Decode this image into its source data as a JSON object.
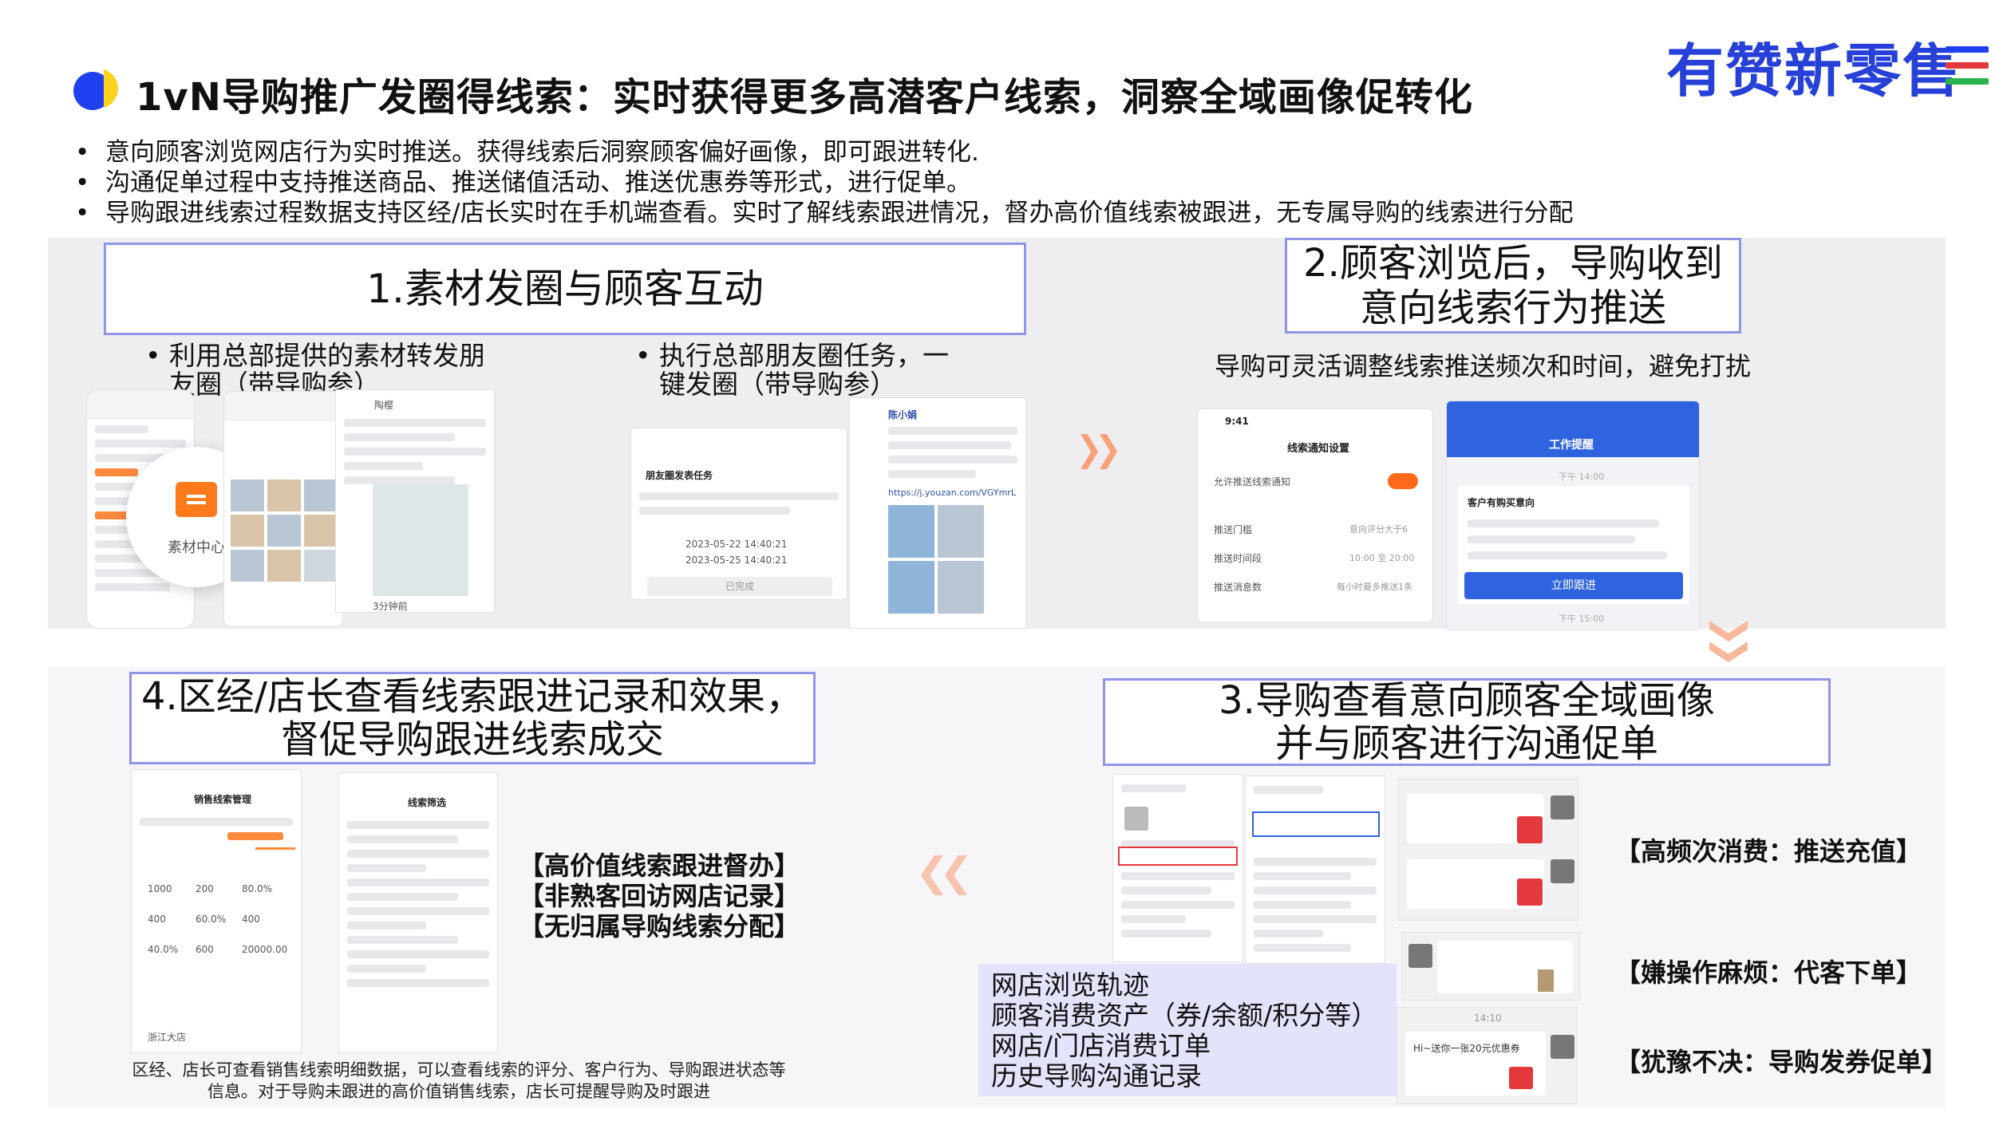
{
  "header": {
    "title": "1vN导购推广发圈得线索：实时获得更多高潜客户线索，洞察全域画像促转化",
    "brand": "有赞新零售",
    "brand_bar_colors": [
      "#1f3ff0",
      "#e4393c",
      "#2bb24c"
    ]
  },
  "bullets": [
    "意向顾客浏览网店行为实时推送。获得线索后洞察顾客偏好画像，即可跟进转化.",
    "沟通促单过程中支持推送商品、推送储值活动、推送优惠券等形式，进行促单。",
    "导购跟进线索过程数据支持区经/店长实时在手机端查看。实时了解线索跟进情况，督办高价值线索被跟进，无专属导购的线索进行分配"
  ],
  "step1": {
    "title": "1.素材发圈与顾客互动",
    "bullet_a": "利用总部提供的素材转发朋友圈（带导购参）",
    "bullet_b": "执行总部朋友圈任务，一键发圈（带导购参）",
    "circle_label": "素材中心",
    "task_title": "朋友圈发表任务",
    "task_done": "已完成",
    "task_start": "2023-05-22 14:40:21",
    "task_end": "2023-05-25 14:40:21",
    "moment_user": "陈小娟",
    "moment_link": "https://j.youzan.com/VGYmrL",
    "moment_user2": "陶樱",
    "moment_time": "3分钟前"
  },
  "step2": {
    "title_line1": "2.顾客浏览后，导购收到",
    "title_line2": "意向线索行为推送",
    "note": "导购可灵活调整线索推送频次和时间，避免打扰",
    "screen1_title": "线索通知设置",
    "screen1_rows": [
      "允许推送线索通知",
      "推送门槛",
      "推送时间段",
      "推送消息数"
    ],
    "screen1_values": [
      "",
      "意向评分大于6",
      "10:00 至 20:00",
      "每小时最多推送1条"
    ],
    "screen2_title": "工作提醒",
    "screen2_card_title": "客户有购买意向",
    "screen2_button": "立即跟进",
    "time_a": "下午 14:00",
    "time_b": "下午 15:00",
    "clock": "9:41"
  },
  "step3": {
    "title_line1": "3.导购查看意向顾客全域画像",
    "title_line2": "并与顾客进行沟通促单",
    "profile_items": [
      "网店浏览轨迹",
      "顾客消费资产（券/余额/积分等）",
      "网店/门店消费订单",
      "历史导购沟通记录"
    ],
    "tags": [
      "【高频次消费：推送充值】",
      "【嫌操作麻烦：代客下单】",
      "【犹豫不决：导购发券促单】"
    ],
    "chat_time": "14:10",
    "chat_coupon": "Hi~送你一张20元优惠券"
  },
  "step4": {
    "title_line1": "4.区经/店长查看线索跟进记录和效果，",
    "title_line2": "督促导购跟进线索成交",
    "tags": [
      "【高价值线索跟进督办】",
      "【非熟客回访网店记录】",
      "【无归属导购线索分配】"
    ],
    "caption": "区经、店长可查看销售线索明细数据，可以查看线索的评分、客户行为、导购跟进状态等信息。对于导购未跟进的高价值销售线索，店长可提醒导购及时跟进",
    "screen1_title": "销售线索管理",
    "screen2_title": "线索筛选",
    "stats": [
      "1000",
      "200",
      "80.0%",
      "400",
      "60.0%",
      "400",
      "40.0%",
      "600",
      "20000.00"
    ],
    "store": "浙江大店"
  }
}
